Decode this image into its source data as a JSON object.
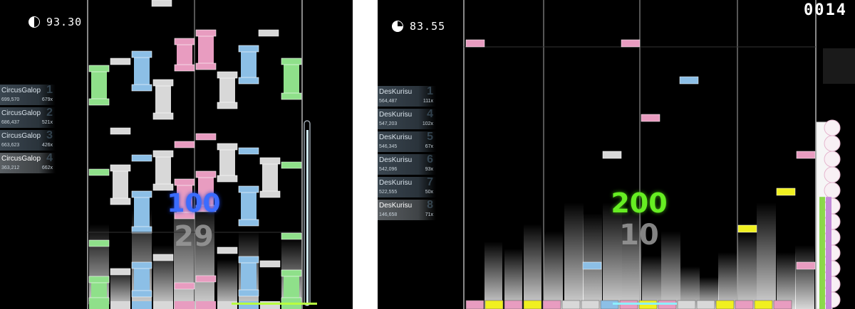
{
  "left_panel": {
    "timer": "93.30",
    "leaderboard": [
      {
        "name": "CircusGalop",
        "score": "699,570",
        "combo": "679x",
        "rank": "1"
      },
      {
        "name": "CircusGalop",
        "score": "686,437",
        "combo": "521x",
        "rank": "2"
      },
      {
        "name": "CircusGalop",
        "score": "663,623",
        "combo": "426x",
        "rank": "3"
      },
      {
        "name": "CircusGalop",
        "score": "363,212",
        "combo": "662x",
        "rank": "4",
        "is_player": true
      }
    ],
    "judgement": "100",
    "combo": "29",
    "health_fraction": 0.95
  },
  "right_panel": {
    "timer": "83.55",
    "score": "0014",
    "leaderboard": [
      {
        "name": "DesKurisu",
        "score": "564,487",
        "combo": "111x",
        "rank": "1"
      },
      {
        "name": "DesKurisu",
        "score": "547,203",
        "combo": "102x",
        "rank": "4"
      },
      {
        "name": "DesKurisu",
        "score": "546,345",
        "combo": "67x",
        "rank": "5"
      },
      {
        "name": "DesKurisu",
        "score": "542,096",
        "combo": "93x",
        "rank": "6"
      },
      {
        "name": "DesKurisu",
        "score": "522,555",
        "combo": "50x",
        "rank": "7"
      },
      {
        "name": "DesKurisu",
        "score": "146,658",
        "combo": "71x",
        "rank": "8",
        "is_player": true
      }
    ],
    "judgement": "200",
    "combo": "10",
    "health_fraction": 0.6
  },
  "colors": {
    "green": "#8fe08a",
    "blue": "#8cbfe6",
    "pink": "#e89cc0",
    "white": "#d8d8d8",
    "yellow": "#f0f020",
    "judge_100": "#3366ff",
    "judge_200": "#66ee22"
  }
}
